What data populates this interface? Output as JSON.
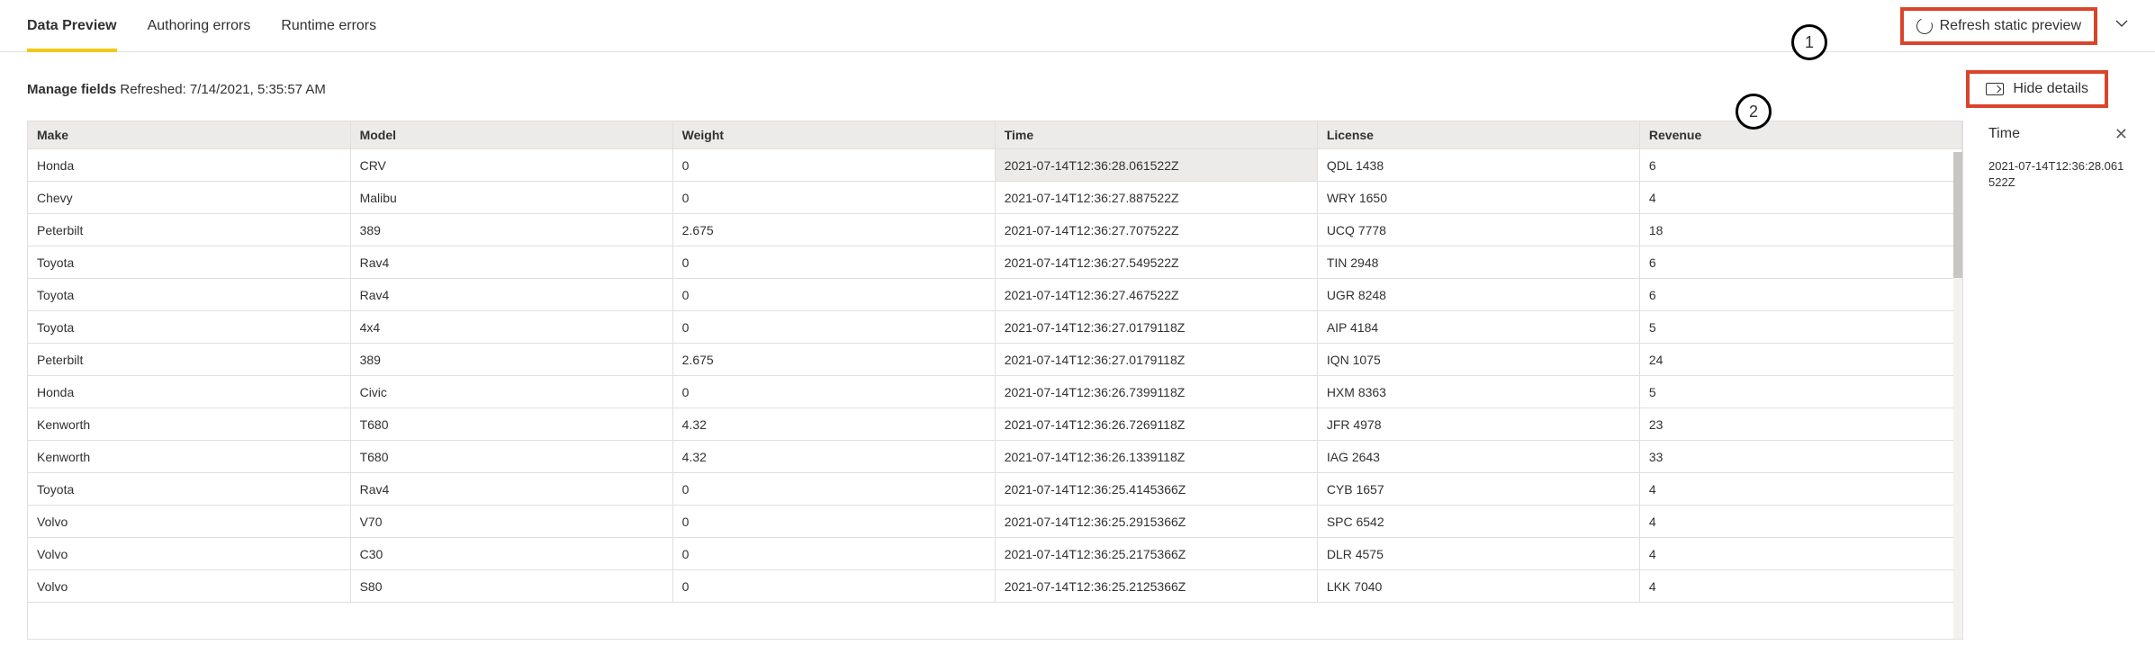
{
  "tabs": {
    "items": [
      {
        "label": "Data Preview",
        "active": true
      },
      {
        "label": "Authoring errors",
        "active": false
      },
      {
        "label": "Runtime errors",
        "active": false
      }
    ]
  },
  "toolbar": {
    "refresh_label": "Refresh static preview"
  },
  "subheader": {
    "manage_label": "Manage fields",
    "refreshed_label": "Refreshed: 7/14/2021, 5:35:57 AM",
    "hide_label": "Hide details"
  },
  "table": {
    "columns": [
      "Make",
      "Model",
      "Weight",
      "Time",
      "License",
      "Revenue"
    ],
    "rows": [
      {
        "make": "Honda",
        "model": "CRV",
        "weight": "0",
        "time": "2021-07-14T12:36:28.061522Z",
        "license": "QDL 1438",
        "revenue": "6"
      },
      {
        "make": "Chevy",
        "model": "Malibu",
        "weight": "0",
        "time": "2021-07-14T12:36:27.887522Z",
        "license": "WRY 1650",
        "revenue": "4"
      },
      {
        "make": "Peterbilt",
        "model": "389",
        "weight": "2.675",
        "time": "2021-07-14T12:36:27.707522Z",
        "license": "UCQ 7778",
        "revenue": "18"
      },
      {
        "make": "Toyota",
        "model": "Rav4",
        "weight": "0",
        "time": "2021-07-14T12:36:27.549522Z",
        "license": "TIN 2948",
        "revenue": "6"
      },
      {
        "make": "Toyota",
        "model": "Rav4",
        "weight": "0",
        "time": "2021-07-14T12:36:27.467522Z",
        "license": "UGR 8248",
        "revenue": "6"
      },
      {
        "make": "Toyota",
        "model": "4x4",
        "weight": "0",
        "time": "2021-07-14T12:36:27.0179118Z",
        "license": "AIP 4184",
        "revenue": "5"
      },
      {
        "make": "Peterbilt",
        "model": "389",
        "weight": "2.675",
        "time": "2021-07-14T12:36:27.0179118Z",
        "license": "IQN 1075",
        "revenue": "24"
      },
      {
        "make": "Honda",
        "model": "Civic",
        "weight": "0",
        "time": "2021-07-14T12:36:26.7399118Z",
        "license": "HXM 8363",
        "revenue": "5"
      },
      {
        "make": "Kenworth",
        "model": "T680",
        "weight": "4.32",
        "time": "2021-07-14T12:36:26.7269118Z",
        "license": "JFR 4978",
        "revenue": "23"
      },
      {
        "make": "Kenworth",
        "model": "T680",
        "weight": "4.32",
        "time": "2021-07-14T12:36:26.1339118Z",
        "license": "IAG 2643",
        "revenue": "33"
      },
      {
        "make": "Toyota",
        "model": "Rav4",
        "weight": "0",
        "time": "2021-07-14T12:36:25.4145366Z",
        "license": "CYB 1657",
        "revenue": "4"
      },
      {
        "make": "Volvo",
        "model": "V70",
        "weight": "0",
        "time": "2021-07-14T12:36:25.2915366Z",
        "license": "SPC 6542",
        "revenue": "4"
      },
      {
        "make": "Volvo",
        "model": "C30",
        "weight": "0",
        "time": "2021-07-14T12:36:25.2175366Z",
        "license": "DLR 4575",
        "revenue": "4"
      },
      {
        "make": "Volvo",
        "model": "S80",
        "weight": "0",
        "time": "2021-07-14T12:36:25.2125366Z",
        "license": "LKK 7040",
        "revenue": "4"
      }
    ]
  },
  "details": {
    "title": "Time",
    "value": "2021-07-14T12:36:28.061522Z"
  },
  "callouts": {
    "one": "1",
    "two": "2"
  }
}
